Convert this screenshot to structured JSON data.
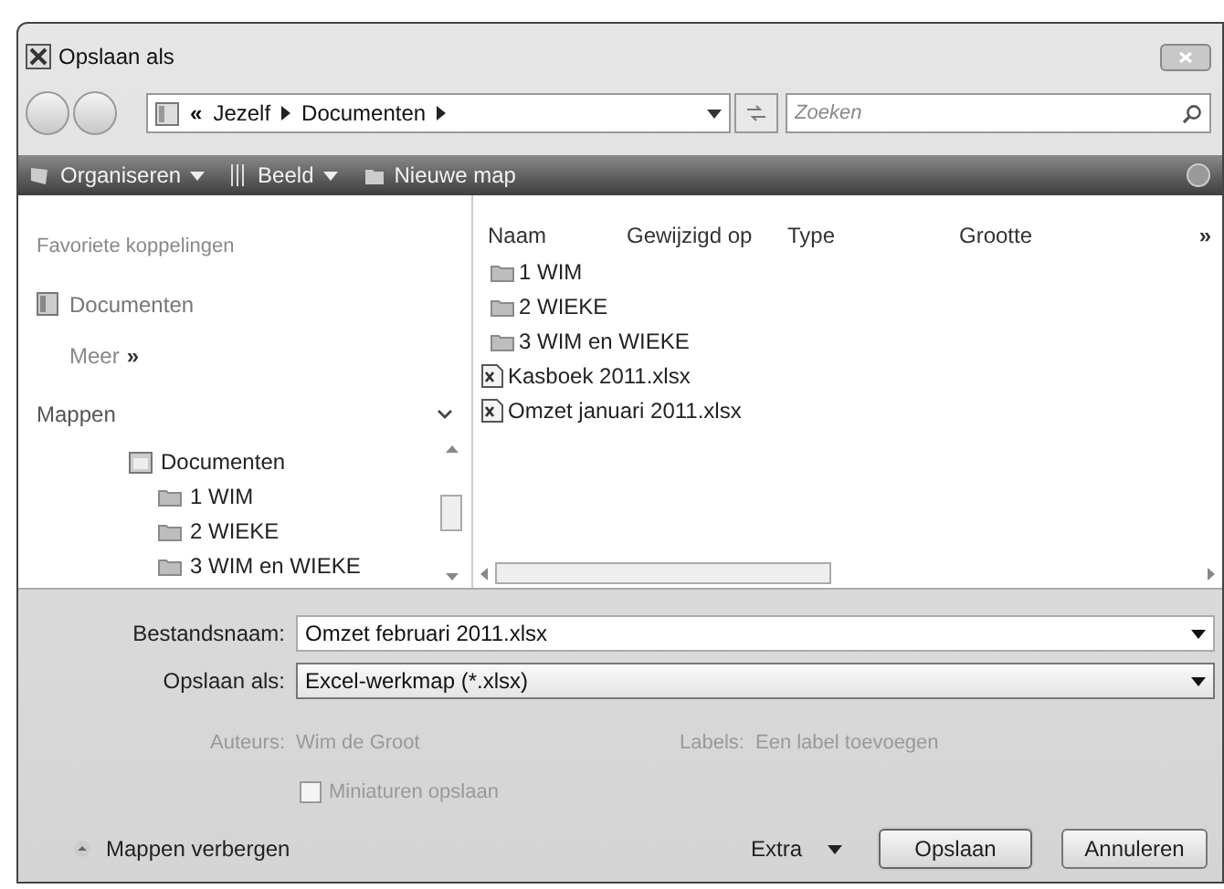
{
  "window": {
    "title": "Opslaan als"
  },
  "address": {
    "overflow": "«",
    "crumbs": [
      "Jezelf",
      "Documenten"
    ]
  },
  "search": {
    "placeholder": "Zoeken"
  },
  "toolbar": [
    {
      "label": "Organiseren",
      "kind": "menu"
    },
    {
      "label": "Beeld",
      "kind": "menu"
    },
    {
      "label": "Nieuwe map",
      "kind": "plain"
    }
  ],
  "favorites": {
    "heading": "Favoriete koppelingen",
    "items": [
      "Documenten"
    ],
    "more": "Meer",
    "more_glyph": "»"
  },
  "folders": {
    "heading": "Mappen",
    "tree": [
      {
        "label": "Documenten",
        "children": [
          {
            "label": "1 WIM"
          },
          {
            "label": "2 WIEKE"
          },
          {
            "label": "3 WIM en WIEKE"
          }
        ]
      }
    ]
  },
  "columns": [
    "Naam",
    "Gewijzigd op",
    "Type",
    "Grootte"
  ],
  "columns_more": "»",
  "files": [
    {
      "name": "1 WIM",
      "kind": "folder"
    },
    {
      "name": "2 WIEKE",
      "kind": "folder"
    },
    {
      "name": "3 WIM en WIEKE",
      "kind": "folder"
    },
    {
      "name": "Kasboek 2011.xlsx",
      "kind": "excel"
    },
    {
      "name": "Omzet januari 2011.xlsx",
      "kind": "excel"
    }
  ],
  "filename": {
    "label": "Bestandsnaam:",
    "value": "Omzet februari 2011.xlsx"
  },
  "filetype": {
    "label": "Opslaan als:",
    "value": "Excel-werkmap (*.xlsx)"
  },
  "authors": {
    "label": "Auteurs:",
    "value": "Wim de Groot"
  },
  "tags": {
    "label": "Labels:",
    "value": "Een label toevoegen"
  },
  "thumbnails": {
    "label": "Miniaturen opslaan",
    "checked": false
  },
  "hide_folders": "Mappen verbergen",
  "buttons": {
    "extra": "Extra",
    "save": "Opslaan",
    "cancel": "Annuleren"
  }
}
